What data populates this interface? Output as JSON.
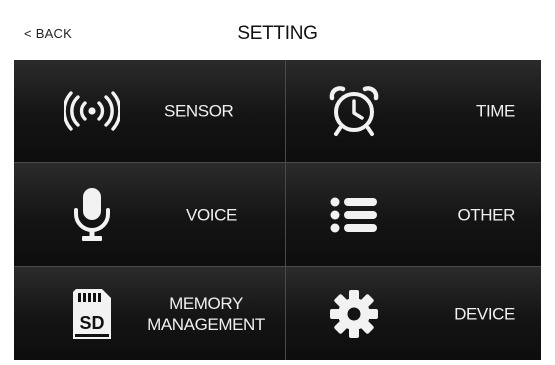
{
  "header": {
    "back_label": "BACK",
    "title": "SETTING"
  },
  "tiles": [
    {
      "label": "SENSOR",
      "icon": "wireless-signal-icon"
    },
    {
      "label": "TIME",
      "icon": "alarm-clock-icon"
    },
    {
      "label": "VOICE",
      "icon": "microphone-icon"
    },
    {
      "label": "OTHER",
      "icon": "list-icon"
    },
    {
      "label_line1": "MEMORY",
      "label_line2": "MANAGEMENT",
      "icon": "sd-card-icon",
      "icon_text": "SD"
    },
    {
      "label": "DEVICE",
      "icon": "gear-icon"
    }
  ],
  "colors": {
    "panel": "#0b0b0b",
    "text_light": "#f0f0f0",
    "divider": "#4a4a4a"
  }
}
